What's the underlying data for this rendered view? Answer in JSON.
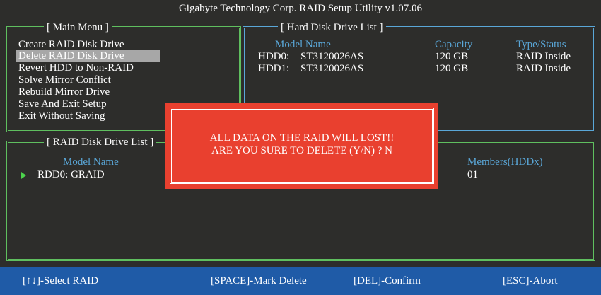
{
  "title": "Gigabyte Technology Corp.  RAID Setup Utility  v1.07.06",
  "main_menu": {
    "label": "[ Main Menu ]",
    "items": [
      "Create RAID Disk Drive",
      "Delete RAID Disk Drive",
      "Revert HDD to Non-RAID",
      "Solve Mirror Conflict",
      "Rebuild Mirror Drive",
      "Save And Exit Setup",
      "Exit Without Saving"
    ]
  },
  "hdd_list": {
    "label": "[ Hard Disk Drive List ]",
    "headers": {
      "model": "Model Name",
      "capacity": "Capacity",
      "type": "Type/Status"
    },
    "rows": [
      {
        "id": "HDD0:",
        "model": "ST3120026AS",
        "capacity": "120 GB",
        "type": "RAID Inside"
      },
      {
        "id": "HDD1:",
        "model": "ST3120026AS",
        "capacity": "120 GB",
        "type": "RAID Inside"
      }
    ]
  },
  "raid_list": {
    "label": "[ RAID Disk Drive List ]",
    "headers": {
      "model": "Model Name",
      "members": "Members(HDDx)"
    },
    "rows": [
      {
        "name": "RDD0: GRAID",
        "members": "01"
      }
    ]
  },
  "dialog": {
    "line1": "ALL DATA ON THE RAID WILL LOST!!",
    "line2": "ARE YOU SURE TO DELETE (Y/N) ? N"
  },
  "footer": {
    "select": "[↑↓]-Select RAID",
    "mark": "[SPACE]-Mark Delete",
    "confirm": "[DEL]-Confirm",
    "abort": "[ESC]-Abort"
  },
  "colors": {
    "background": "#2d2d2b",
    "box_green": "#5fbf5f",
    "box_blue": "#5aa7d8",
    "header_text": "#5aa7d8",
    "selected_bg": "#a7a7a7",
    "dialog_bg": "#e9402f",
    "footer_bg": "#1f5ba7",
    "pointer": "#4cd24c"
  }
}
